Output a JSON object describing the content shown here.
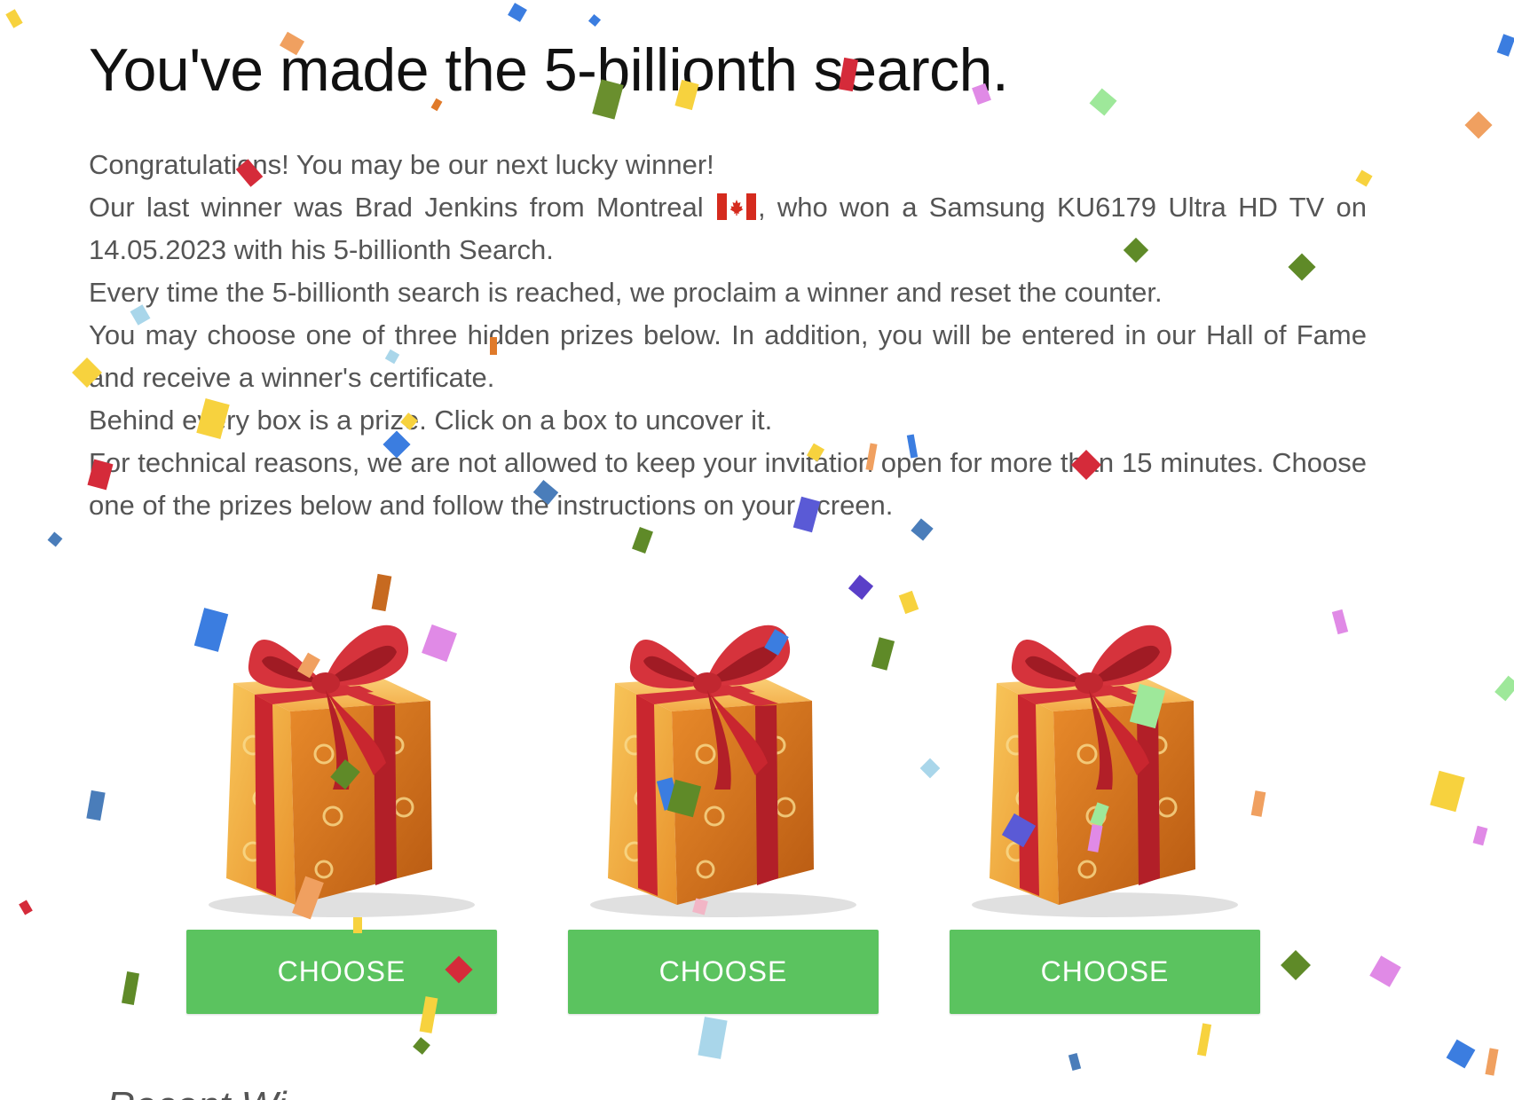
{
  "headline": "You've made the 5-billionth search.",
  "paragraphs": {
    "p1": "Congratulations! You may be our next lucky winner!",
    "p2_before_flag": "Our last winner was Brad Jenkins from Montreal ",
    "p2_after_flag": ", who won a Samsung KU6179 Ultra HD TV on 14.05.2023 with his 5-billionth Search.",
    "p3": "Every time the 5-billionth search is reached, we proclaim a winner and reset the counter.",
    "p4": "You may choose one of three hidden prizes below. In addition, you will be entered in our Hall of Fame and receive a winner's certificate.",
    "p5": "Behind every box is a prize. Click on a box to uncover it.",
    "p6": "For technical reasons, we are not allowed to keep your invitation open for more than 15 minutes. Choose one of the prizes below and follow the instructions on your screen."
  },
  "flag_icon": "canada-flag-icon",
  "prizes": [
    {
      "button_label": "CHOOSE",
      "icon": "gift-box-icon"
    },
    {
      "button_label": "CHOOSE",
      "icon": "gift-box-icon"
    },
    {
      "button_label": "CHOOSE",
      "icon": "gift-box-icon"
    }
  ],
  "recent_winners_heading": "Recent Wi",
  "colors": {
    "button_green": "#5bc35f",
    "title_text": "#111111",
    "body_text": "#555555",
    "ribbon_red": "#cc2a35",
    "box_gold": "#f0a23a"
  }
}
